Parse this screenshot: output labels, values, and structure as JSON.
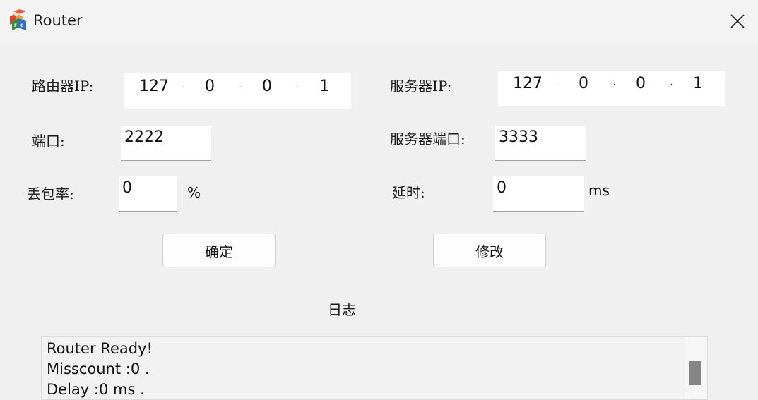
{
  "window": {
    "title": "Router",
    "icon": "mfc-app-icon",
    "close_icon": "close-icon"
  },
  "router": {
    "ip_label": "路由器IP:",
    "ip": [
      "127",
      "0",
      "0",
      "1"
    ],
    "port_label": "端口:",
    "port": "2222",
    "loss_label": "丢包率:",
    "loss": "0",
    "loss_unit": "%"
  },
  "server": {
    "ip_label": "服务器IP:",
    "ip": [
      "127",
      "0",
      "0",
      "1"
    ],
    "port_label": "服务器端口:",
    "port": "3333",
    "delay_label": "延时:",
    "delay": "0",
    "delay_unit": "ms"
  },
  "buttons": {
    "confirm": "确定",
    "modify": "修改"
  },
  "log": {
    "label": "日志",
    "lines": [
      "Router Ready!",
      "Misscount :0 .",
      "Delay :0 ms ."
    ]
  }
}
